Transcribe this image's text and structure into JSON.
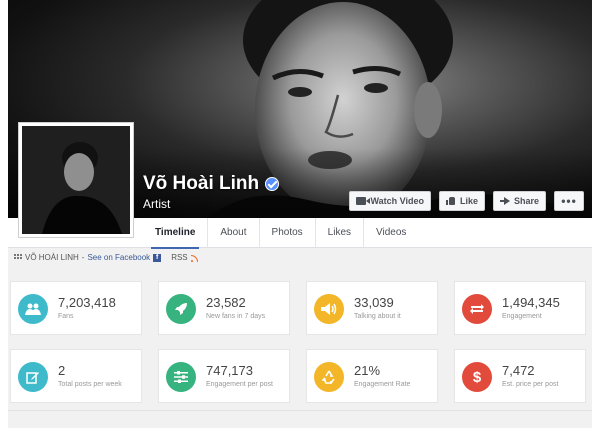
{
  "page": {
    "name": "Võ Hoài Linh",
    "category": "Artist"
  },
  "actions": {
    "watch_video": "Watch Video",
    "like": "Like",
    "share": "Share",
    "more": "•••"
  },
  "tabs": [
    {
      "label": "Timeline",
      "active": true
    },
    {
      "label": "About",
      "active": false
    },
    {
      "label": "Photos",
      "active": false
    },
    {
      "label": "Likes",
      "active": false
    },
    {
      "label": "Videos",
      "active": false
    }
  ],
  "breadcrumb": {
    "page_name": "VÕ HOÀI LINH",
    "separator": " - ",
    "link": "See on Facebook",
    "rss": "RSS"
  },
  "stats": [
    {
      "value": "7,203,418",
      "label": "Fans",
      "icon": "users-icon",
      "color": "#3ebacb",
      "glyph": "👥"
    },
    {
      "value": "23,582",
      "label": "New fans in 7 days",
      "icon": "rocket-icon",
      "color": "#36b37e",
      "glyph": "🚀"
    },
    {
      "value": "33,039",
      "label": "Talking about it",
      "icon": "megaphone-icon",
      "color": "#f2b628",
      "glyph": "📢"
    },
    {
      "value": "1,494,345",
      "label": "Engagement",
      "icon": "exchange-icon",
      "color": "#e24a3b",
      "glyph": "⇄"
    },
    {
      "value": "2",
      "label": "Total posts per week",
      "icon": "edit-icon",
      "color": "#3ebacb",
      "glyph": "✎"
    },
    {
      "value": "747,173",
      "label": "Engagement per post",
      "icon": "sliders-icon",
      "color": "#36b37e",
      "glyph": "☰"
    },
    {
      "value": "21%",
      "label": "Engagement Rate",
      "icon": "recycle-icon",
      "color": "#f2b628",
      "glyph": "♻"
    },
    {
      "value": "7,472",
      "label": "Est. price per post",
      "icon": "dollar-icon",
      "color": "#e24a3b",
      "glyph": "$"
    }
  ],
  "colors": {
    "fb_blue": "#3b5998",
    "active_tab_underline": "#4267b2",
    "verified_badge": "#5890ff"
  }
}
